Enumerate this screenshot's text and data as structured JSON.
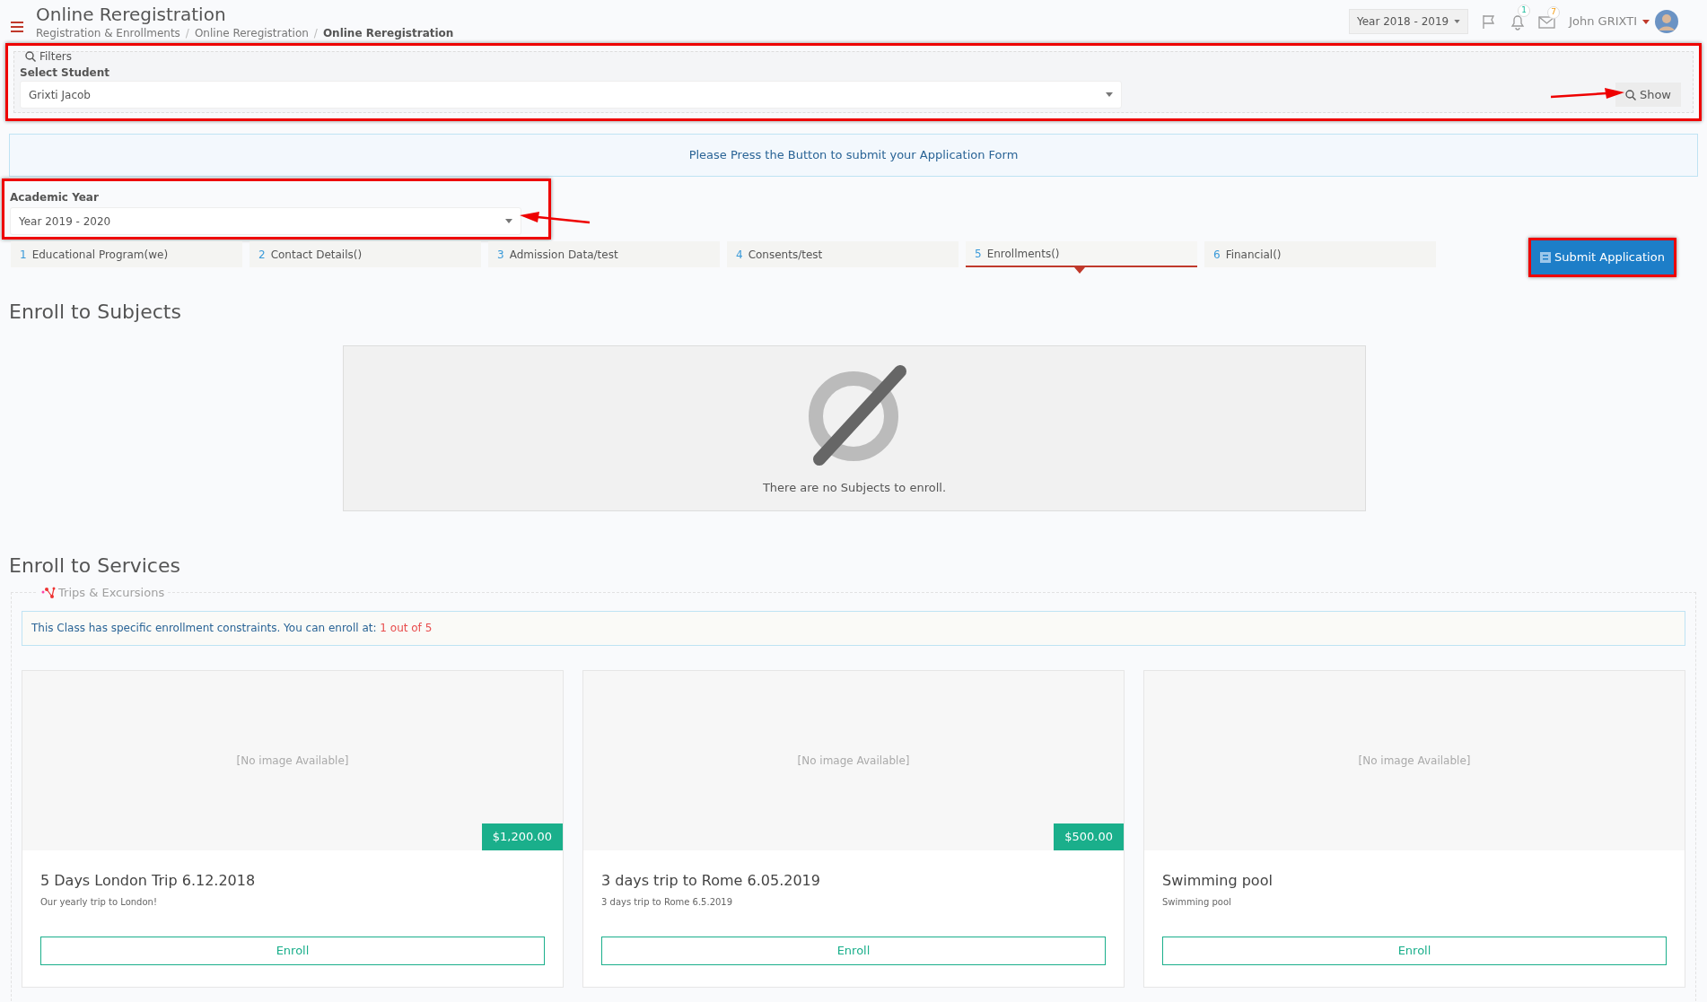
{
  "header": {
    "title": "Online Reregistration",
    "breadcrumbs": [
      "Registration & Enrollments",
      "Online Reregistration",
      "Online Reregistration"
    ],
    "breadcrumb_separator": "/",
    "year_selector": "Year 2018 - 2019",
    "notifications_count": "1",
    "messages_count": "7",
    "user_name": "John GRIXTI"
  },
  "filters": {
    "legend": "Filters",
    "student_label": "Select Student",
    "student_value": "Grixti Jacob",
    "show_button": "Show"
  },
  "info_banner": "Please Press the Button to submit your Application Form",
  "academic_year": {
    "label": "Academic Year",
    "value": "Year 2019 - 2020"
  },
  "tabs": [
    {
      "number": "1",
      "label": "Educational Program(we)",
      "selected": false
    },
    {
      "number": "2",
      "label": "Contact Details()",
      "selected": false
    },
    {
      "number": "3",
      "label": "Admission Data/test",
      "selected": false
    },
    {
      "number": "4",
      "label": "Consents/test",
      "selected": false
    },
    {
      "number": "5",
      "label": "Enrollments()",
      "selected": true
    },
    {
      "number": "6",
      "label": "Financial()",
      "selected": false
    }
  ],
  "submit_button": "Submit Application",
  "subjects": {
    "heading": "Enroll to Subjects",
    "empty_message": "There are no Subjects to enroll."
  },
  "services": {
    "heading": "Enroll to Services",
    "group_legend": "Trips & Excursions",
    "constraint_text": "This Class has specific enrollment constraints. You can enroll at: ",
    "constraint_value": "1 out of 5",
    "cards": [
      {
        "image_text": "[No image Available]",
        "price": "$1,200.00",
        "title": "5 Days London Trip 6.12.2018",
        "description": "Our yearly trip to London!",
        "button": "Enroll"
      },
      {
        "image_text": "[No image Available]",
        "price": "$500.00",
        "title": "3 days trip to Rome 6.05.2019",
        "description": "3 days trip to Rome 6.5.2019",
        "button": "Enroll"
      },
      {
        "image_text": "[No image Available]",
        "title": "Swimming pool",
        "description": "Swimming pool",
        "button": "Enroll"
      }
    ]
  }
}
